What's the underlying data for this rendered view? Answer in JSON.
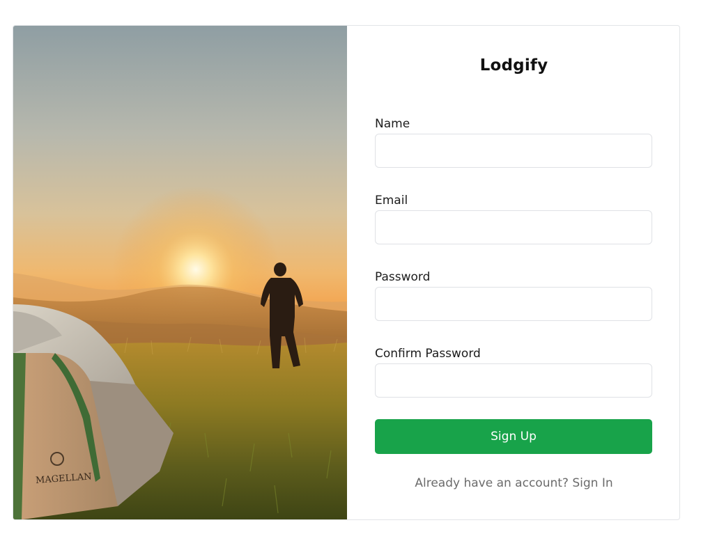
{
  "brand": {
    "name": "Lodgify"
  },
  "form": {
    "fields": [
      {
        "label": "Name",
        "value": "",
        "placeholder": ""
      },
      {
        "label": "Email",
        "value": "",
        "placeholder": ""
      },
      {
        "label": "Password",
        "value": "",
        "placeholder": ""
      },
      {
        "label": "Confirm Password",
        "value": "",
        "placeholder": ""
      }
    ],
    "submit_label": "Sign Up",
    "signin_prompt": "Already have an account?",
    "signin_link": "Sign In"
  },
  "hero_image": {
    "tent_logo_text": "MAGELLAN"
  },
  "colors": {
    "accent": "#18a34a",
    "muted_text": "#6b6b6b",
    "border": "#e2e4e7"
  }
}
